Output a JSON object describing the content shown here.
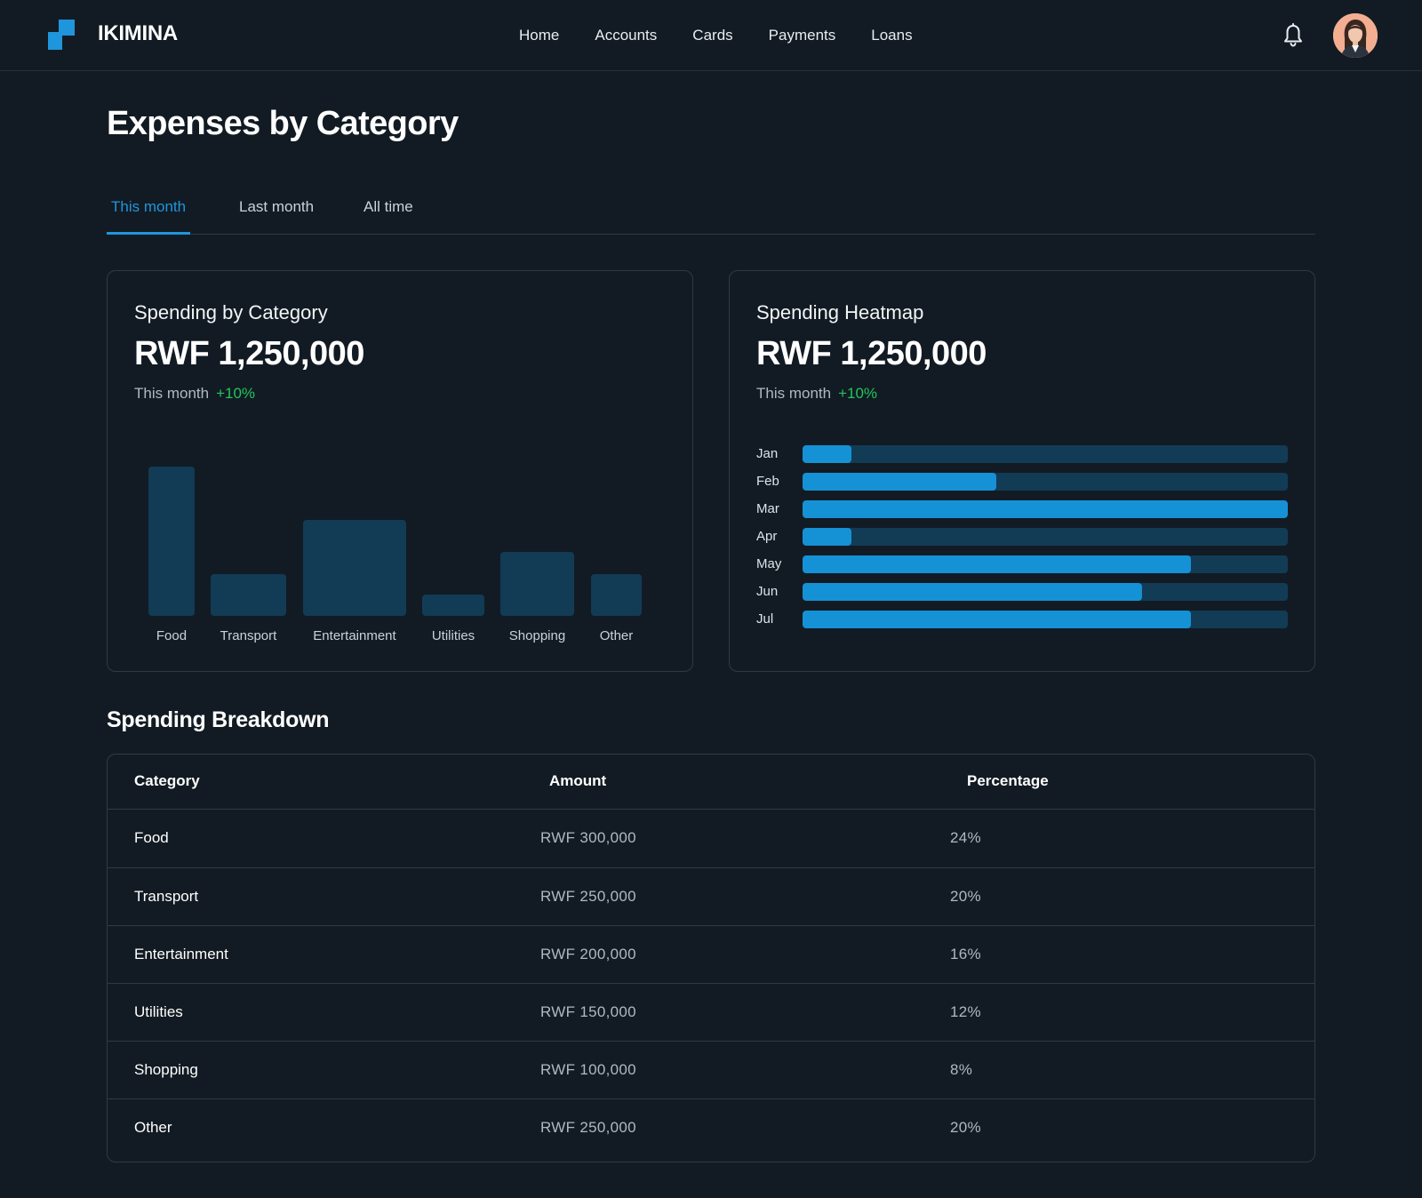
{
  "header": {
    "brand": "IKIMINA",
    "nav": [
      "Home",
      "Accounts",
      "Cards",
      "Payments",
      "Loans"
    ],
    "icons": {
      "logo": "logo-icon",
      "bell": "bell-icon",
      "avatar": "user-avatar"
    },
    "accent": "#1f95dc"
  },
  "page": {
    "title": "Expenses by Category",
    "tabs": [
      {
        "label": "This month",
        "active": true
      },
      {
        "label": "Last month",
        "active": false
      },
      {
        "label": "All time",
        "active": false
      }
    ]
  },
  "cards": {
    "category": {
      "title": "Spending by Category",
      "amount": "RWF 1,250,000",
      "period": "This month",
      "delta": "+10%"
    },
    "heatmap": {
      "title": "Spending Heatmap",
      "amount": "RWF 1,250,000",
      "period": "This month",
      "delta": "+10%"
    }
  },
  "chart_data": [
    {
      "type": "bar",
      "categories": [
        "Food",
        "Transport",
        "Entertainment",
        "Utilities",
        "Shopping",
        "Other"
      ],
      "values": [
        100,
        28,
        64,
        14,
        43,
        28
      ],
      "colors": {
        "bar": "#123b56"
      }
    },
    {
      "type": "bar",
      "orientation": "horizontal",
      "categories": [
        "Jan",
        "Feb",
        "Mar",
        "Apr",
        "May",
        "Jun",
        "Jul"
      ],
      "values": [
        0.1,
        0.4,
        1.0,
        0.1,
        0.8,
        0.7,
        0.8
      ],
      "colors": {
        "fill": "#1591d6",
        "track": "#123b56"
      }
    }
  ],
  "breakdown": {
    "title": "Spending Breakdown",
    "columns": [
      "Category",
      "Amount",
      "Percentage"
    ],
    "rows": [
      {
        "category": "Food",
        "amount": "RWF 300,000",
        "percentage": "24%"
      },
      {
        "category": "Transport",
        "amount": "RWF 250,000",
        "percentage": "20%"
      },
      {
        "category": "Entertainment",
        "amount": "RWF 200,000",
        "percentage": "16%"
      },
      {
        "category": "Utilities",
        "amount": "RWF 150,000",
        "percentage": "12%"
      },
      {
        "category": "Shopping",
        "amount": "RWF 100,000",
        "percentage": "8%"
      },
      {
        "category": "Other",
        "amount": "RWF 250,000",
        "percentage": "20%"
      }
    ]
  }
}
